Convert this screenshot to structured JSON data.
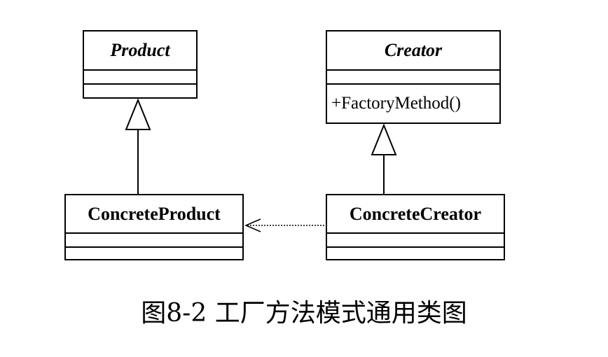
{
  "classes": {
    "product": {
      "name": "Product",
      "abstract": true
    },
    "creator": {
      "name": "Creator",
      "abstract": true,
      "operation": "+FactoryMethod()"
    },
    "concrete_product": {
      "name": "ConcreteProduct"
    },
    "concrete_creator": {
      "name": "ConcreteCreator"
    }
  },
  "relations": [
    {
      "type": "generalization",
      "from": "ConcreteProduct",
      "to": "Product"
    },
    {
      "type": "generalization",
      "from": "ConcreteCreator",
      "to": "Creator"
    },
    {
      "type": "dependency",
      "from": "ConcreteCreator",
      "to": "ConcreteProduct"
    }
  ],
  "caption": "图8-2 工厂方法模式通用类图"
}
